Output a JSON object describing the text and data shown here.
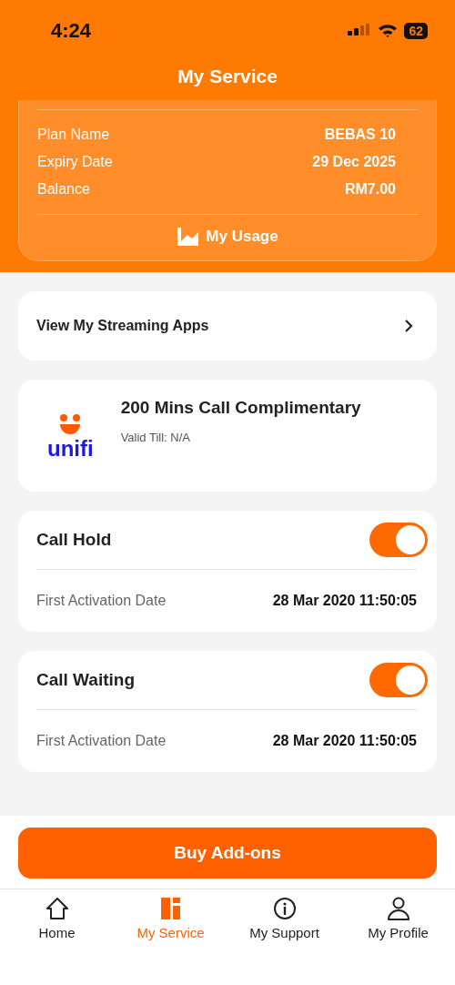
{
  "status_bar": {
    "time": "4:24",
    "battery": "62"
  },
  "header": {
    "title": "My Service"
  },
  "plan": {
    "rows": [
      {
        "label": "Plan Name",
        "value": "BEBAS 10"
      },
      {
        "label": "Expiry Date",
        "value": "29 Dec 2025"
      },
      {
        "label": "Balance",
        "value": "RM7.00"
      }
    ],
    "usage_link": "My Usage"
  },
  "streaming": {
    "label": "View My Streaming Apps"
  },
  "promo": {
    "logo": "unifi",
    "title": "200 Mins Call Complimentary",
    "subtitle": "Valid Till: N/A"
  },
  "features": [
    {
      "name": "Call Hold",
      "on": true,
      "detail_label": "First Activation Date",
      "detail_value": "28 Mar 2020 11:50:05"
    },
    {
      "name": "Call Waiting",
      "on": true,
      "detail_label": "First Activation Date",
      "detail_value": "28 Mar 2020 11:50:05"
    }
  ],
  "action_button": "Buy Add-ons",
  "nav": [
    {
      "label": "Home",
      "selected": false
    },
    {
      "label": "My Service",
      "selected": true
    },
    {
      "label": "My Support",
      "selected": false
    },
    {
      "label": "My Profile",
      "selected": false
    }
  ]
}
